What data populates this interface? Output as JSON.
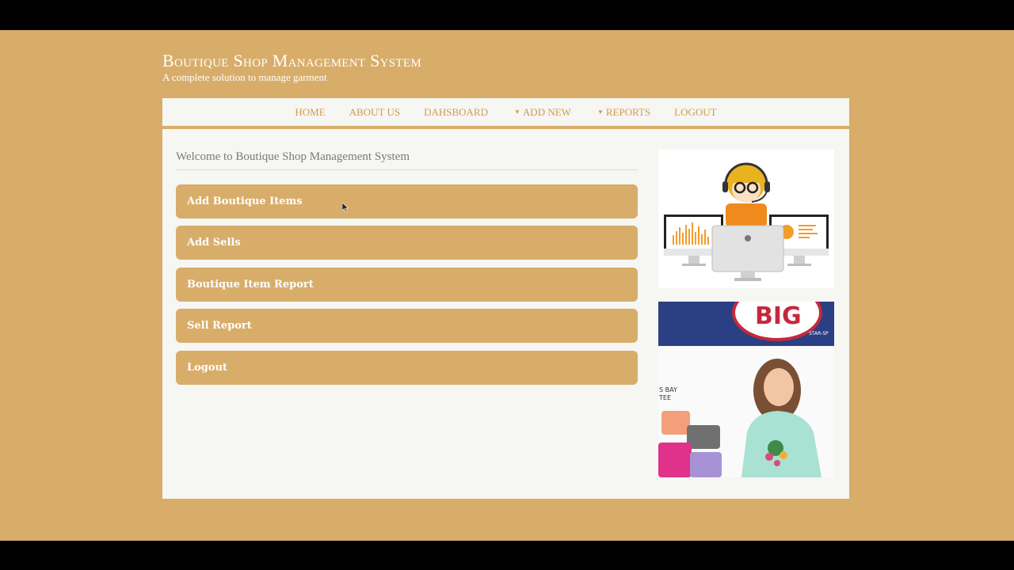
{
  "header": {
    "title": "Boutique Shop Management System",
    "tagline": "A complete solution to manage garment"
  },
  "nav": {
    "home": "HOME",
    "about": "ABOUT US",
    "dashboard": "DAHSBOARD",
    "add_new": "ADD NEW",
    "reports": "REPORTS",
    "logout": "LOGOUT"
  },
  "main": {
    "welcome": "Welcome to Boutique Shop Management System",
    "buttons": [
      "Add Boutique Items",
      "Add Sells",
      "Boutique Item Report",
      "Sell Report",
      "Logout"
    ]
  },
  "sidebar": {
    "banner_big_text": "BIG",
    "banner_small_text": "STAR-SP",
    "banner_side_text_1": "S BAY",
    "banner_side_text_2": "TEE"
  },
  "colors": {
    "background": "#d8ad6a",
    "panel": "#f6f6f3",
    "accent": "#d29a4c",
    "button": "#d8ad6a"
  }
}
